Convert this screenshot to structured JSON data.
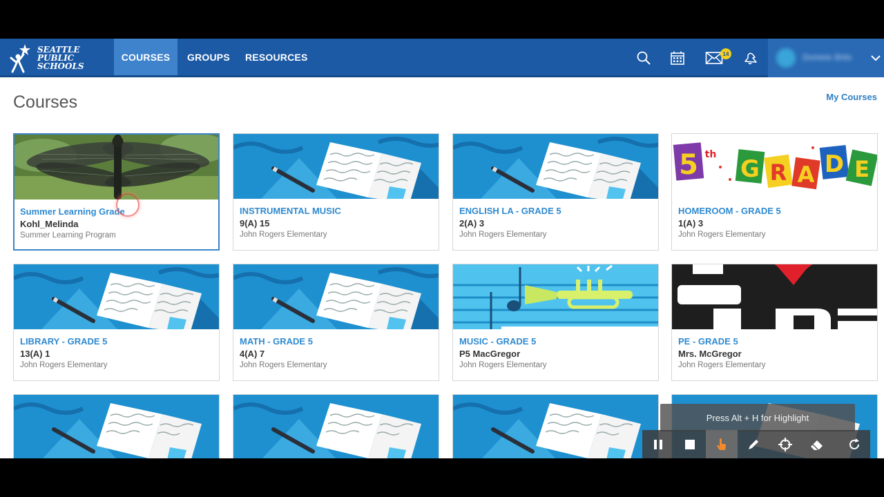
{
  "header": {
    "logo_text": [
      "SEATTLE",
      "PUBLIC",
      "SCHOOLS"
    ],
    "nav": [
      {
        "label": "COURSES",
        "active": true
      },
      {
        "label": "GROUPS",
        "active": false
      },
      {
        "label": "RESOURCES",
        "active": false
      }
    ],
    "icons": [
      "search-icon",
      "calendar-icon",
      "mail-icon",
      "notifications-icon"
    ],
    "mail_badge": "14",
    "user_name": "Dominic Brito",
    "colors": {
      "bar": "#1c5aa6",
      "active_tab": "#3f83cc",
      "badge": "#f3cf1e"
    }
  },
  "page": {
    "title": "Courses",
    "my_courses_link": "My Courses"
  },
  "courses": [
    {
      "title": "Summer Learning Grade",
      "section": "Kohl_Melinda",
      "school": "Summer Learning Program",
      "image": "dragonfly-photo"
    },
    {
      "title": "INSTRUMENTAL MUSIC",
      "section": "9(A) 15",
      "school": "John Rogers Elementary",
      "image": "book-illustration"
    },
    {
      "title": "ENGLISH LA - GRADE 5",
      "section": "2(A) 3",
      "school": "John Rogers Elementary",
      "image": "book-illustration"
    },
    {
      "title": "HOMEROOM - GRADE 5",
      "section": "1(A) 3",
      "school": "John Rogers Elementary",
      "image": "5th-grade-banner"
    },
    {
      "title": "LIBRARY - GRADE 5",
      "section": "13(A) 1",
      "school": "John Rogers Elementary",
      "image": "book-illustration"
    },
    {
      "title": "MATH - GRADE 5",
      "section": "4(A) 7",
      "school": "John Rogers Elementary",
      "image": "book-illustration"
    },
    {
      "title": "MUSIC - GRADE 5",
      "section": "P5 MacGregor",
      "school": "John Rogers Elementary",
      "image": "trumpet-illustration"
    },
    {
      "title": "PE - GRADE 5",
      "section": "Mrs. McGregor",
      "school": "John Rogers Elementary",
      "image": "i-heart-pe"
    }
  ],
  "recorder": {
    "hint": "Press Alt + H for Highlight",
    "tools": [
      "pause-icon",
      "stop-icon",
      "pointer-icon",
      "pen-icon",
      "crosshair-icon",
      "eraser-icon",
      "refresh-icon"
    ]
  }
}
